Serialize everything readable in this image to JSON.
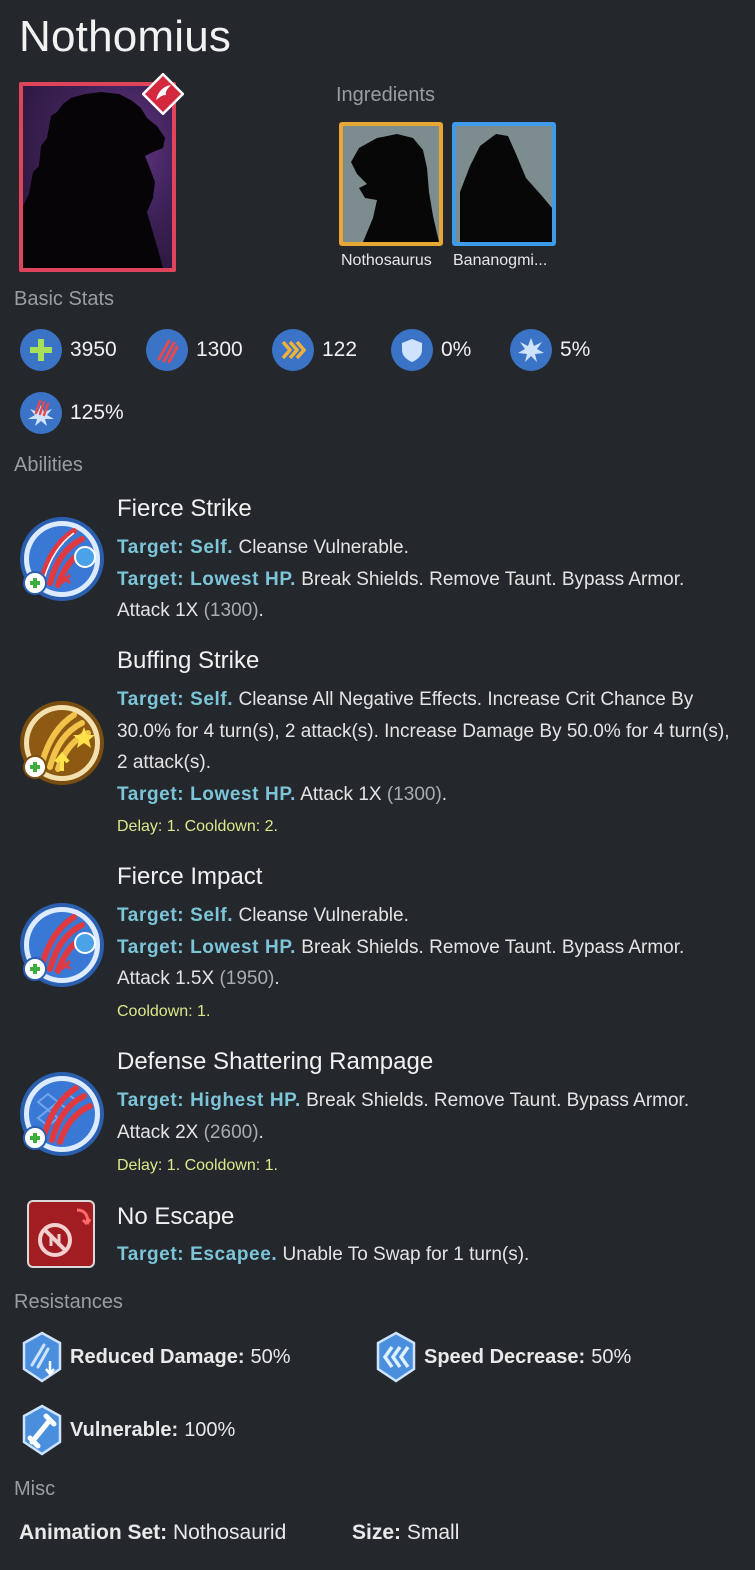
{
  "creature": {
    "name": "Nothomius"
  },
  "ingredients": {
    "label": "Ingredients",
    "items": [
      {
        "name": "Nothosaurus",
        "rarity_color": "#e8a732"
      },
      {
        "name": "Bananogmi...",
        "rarity_color": "#3e9be8"
      }
    ]
  },
  "basic_stats": {
    "label": "Basic Stats",
    "health": "3950",
    "damage": "1300",
    "speed": "122",
    "armor": "0%",
    "crit_chance": "5%",
    "crit_multiplier": "125%"
  },
  "abilities": {
    "label": "Abilities",
    "items": [
      {
        "name": "Fierce Strike",
        "t1": "Target: Self.",
        "e1": " Cleanse Vulnerable.",
        "t2": "Target: Lowest HP.",
        "e2": " Break Shields. Remove Taunt. Bypass Armor. Attack 1X ",
        "n2": "(1300)",
        "p2": "."
      },
      {
        "name": "Buffing Strike",
        "t1": "Target: Self.",
        "e1": " Cleanse All Negative Effects. Increase Crit Chance By 30.0% for 4 turn(s), 2 attack(s). Increase Damage By 50.0% for 4 turn(s), 2 attack(s).",
        "t2": "Target: Lowest HP.",
        "e2": " Attack 1X ",
        "n2": "(1300)",
        "p2": ".",
        "timing": "Delay: 1. Cooldown: 2."
      },
      {
        "name": "Fierce Impact",
        "t1": "Target: Self.",
        "e1": " Cleanse Vulnerable.",
        "t2": "Target: Lowest HP.",
        "e2": " Break Shields. Remove Taunt. Bypass Armor. Attack 1.5X ",
        "n2": "(1950)",
        "p2": ".",
        "timing": "Cooldown: 1."
      },
      {
        "name": "Defense Shattering Rampage",
        "t1": "Target: Highest HP.",
        "e1": " Break Shields. Remove Taunt. Bypass Armor. Attack 2X ",
        "n1": "(2600)",
        "p1": ".",
        "timing": "Delay: 1. Cooldown: 1."
      },
      {
        "name": "No Escape",
        "t1": "Target: Escapee.",
        "e1": " Unable To Swap for 1 turn(s)."
      }
    ]
  },
  "resistances": {
    "label": "Resistances",
    "items": [
      {
        "name": "Reduced Damage:",
        "value": "50%"
      },
      {
        "name": "Speed Decrease:",
        "value": "50%"
      },
      {
        "name": "Vulnerable:",
        "value": "100%"
      }
    ]
  },
  "misc": {
    "label": "Misc",
    "animation_set_label": "Animation Set:",
    "animation_set": "Nothosaurid",
    "size_label": "Size:",
    "size": "Small"
  },
  "colors": {
    "background": "#24272c",
    "target_text": "#7cc5d9",
    "cooldown_text": "#dbe88a",
    "stat_icon_bg": "#3b73c7",
    "portrait_border": "#e0445a"
  }
}
